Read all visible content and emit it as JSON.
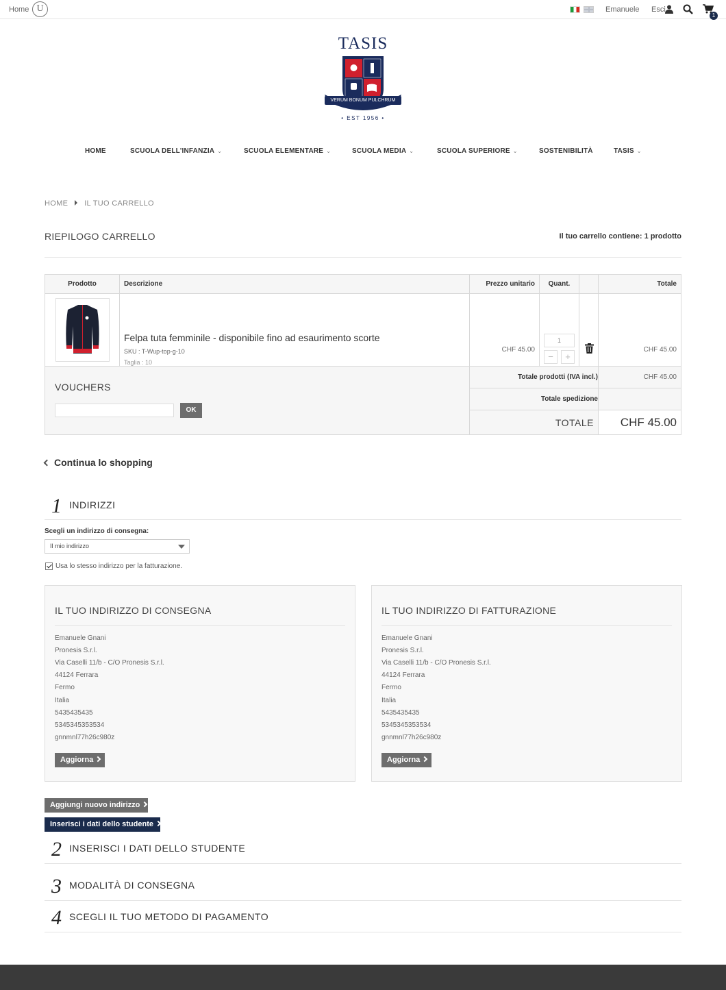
{
  "topbar": {
    "home": "Home",
    "logo_letter": "U",
    "user": "Emanuele",
    "logout": "Esci",
    "cart_count": "1"
  },
  "logo": {
    "name": "TASIS",
    "motto": "VERUM BONUM PULCHRUM",
    "est": "• EST 1956 •"
  },
  "nav": [
    {
      "label": "HOME",
      "caret": false
    },
    {
      "label": "SCUOLA DELL'INFANZIA",
      "caret": true
    },
    {
      "label": "SCUOLA ELEMENTARE",
      "caret": true
    },
    {
      "label": "SCUOLA MEDIA",
      "caret": true
    },
    {
      "label": "SCUOLA SUPERIORE",
      "caret": true
    },
    {
      "label": "SOSTENIBILITÀ",
      "caret": false
    },
    {
      "label": "TASIS",
      "caret": true
    }
  ],
  "breadcrumb": {
    "home": "HOME",
    "current": "IL TUO CARRELLO"
  },
  "cart": {
    "title": "RIEPILOGO CARRELLO",
    "count_text": "Il tuo carrello contiene: 1 prodotto",
    "headers": {
      "product": "Prodotto",
      "description": "Descrizione",
      "unit_price": "Prezzo unitario",
      "qty": "Quant.",
      "total": "Totale"
    },
    "item": {
      "name": "Felpa tuta femminile - disponibile fino ad esaurimento scorte",
      "sku": "SKU : T-Wup-top-g-10",
      "size": "Taglia : 10",
      "unit_price": "CHF 45.00",
      "qty": "1",
      "total": "CHF 45.00"
    },
    "voucher": {
      "title": "VOUCHERS",
      "button": "OK"
    },
    "summary": {
      "products_label": "Totale prodotti (IVA incl.)",
      "products_value": "CHF 45.00",
      "shipping_label": "Totale spedizione",
      "shipping_value": "",
      "total_label": "TOTALE",
      "total_value": "CHF 45.00"
    }
  },
  "continue_shopping": "Continua lo shopping",
  "steps": [
    {
      "num": "1",
      "title": "INDIRIZZI"
    },
    {
      "num": "2",
      "title": "INSERISCI I DATI DELLO STUDENTE"
    },
    {
      "num": "3",
      "title": "MODALITÀ DI CONSEGNA"
    },
    {
      "num": "4",
      "title": "SCEGLI IL TUO METODO DI PAGAMENTO"
    }
  ],
  "address_choice": {
    "label": "Scegli un indirizzo di consegna:",
    "selected": "Il mio indirizzo",
    "same_billing": "Usa lo stesso indirizzo per la fatturazione."
  },
  "delivery_address": {
    "title": "IL TUO INDIRIZZO DI CONSEGNA",
    "lines": [
      "Emanuele Gnani",
      "Pronesis S.r.l.",
      "Via Caselli 11/b - C/O Pronesis S.r.l.",
      "44124 Ferrara",
      "Fermo",
      "Italia",
      "5435435435",
      "5345345353534",
      "gnnmnl77h26c980z"
    ],
    "button": "Aggiorna"
  },
  "billing_address": {
    "title": "IL TUO INDIRIZZO DI FATTURAZIONE",
    "lines": [
      "Emanuele Gnani",
      "Pronesis S.r.l.",
      "Via Caselli 11/b - C/O Pronesis S.r.l.",
      "44124 Ferrara",
      "Fermo",
      "Italia",
      "5435435435",
      "5345345353534",
      "gnnmnl77h26c980z"
    ],
    "button": "Aggiorna"
  },
  "buttons": {
    "add_address": "Aggiungi nuovo indirizzo",
    "student_data": "Inserisci i dati dello studente"
  },
  "colors": {
    "brand_navy": "#1a2b4c",
    "button_gray": "#6d6d6d",
    "footer": "#3a3a3a",
    "crest_red": "#d0202e"
  }
}
